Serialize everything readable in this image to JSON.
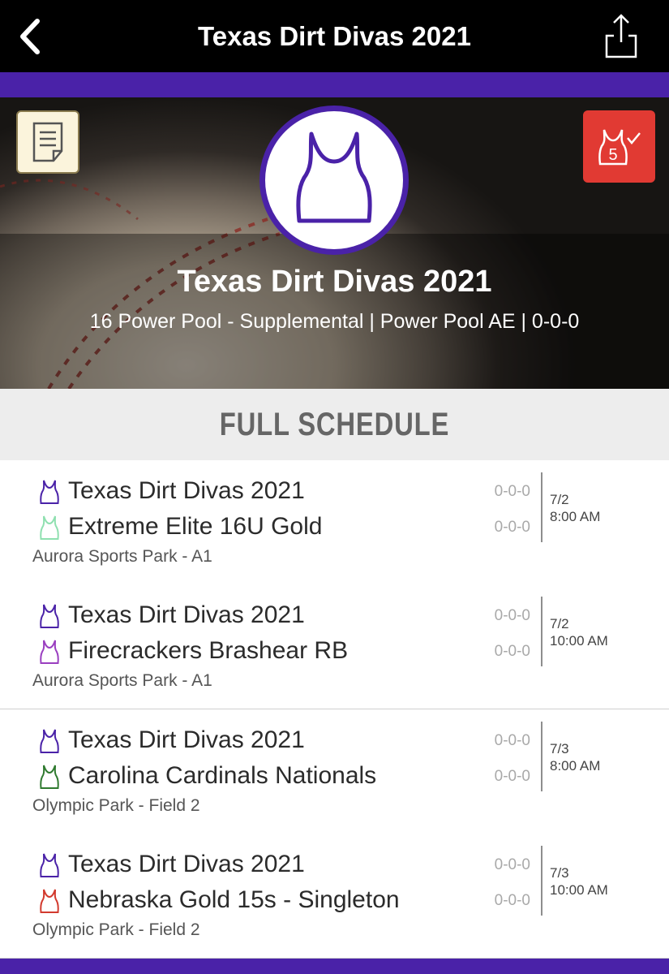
{
  "header": {
    "title": "Texas Dirt Divas 2021"
  },
  "hero": {
    "team_name": "Texas Dirt Divas 2021",
    "subtitle": "16 Power Pool - Supplemental | Power Pool AE | 0-0-0",
    "badge_number": "5"
  },
  "section": {
    "title": "FULL SCHEDULE"
  },
  "games": [
    {
      "home": "Texas Dirt Divas 2021",
      "home_color": "#4a22a8",
      "away": "Extreme Elite 16U Gold",
      "away_color": "#8fe0b0",
      "home_record": "0-0-0",
      "away_record": "0-0-0",
      "date": "7/2",
      "time": "8:00 AM",
      "venue": "Aurora Sports Park - A1"
    },
    {
      "home": "Texas Dirt Divas 2021",
      "home_color": "#4a22a8",
      "away": "Firecrackers Brashear RB",
      "away_color": "#9a3fc0",
      "home_record": "0-0-0",
      "away_record": "0-0-0",
      "date": "7/2",
      "time": "10:00 AM",
      "venue": "Aurora Sports Park - A1"
    },
    {
      "home": "Texas Dirt Divas 2021",
      "home_color": "#4a22a8",
      "away": "Carolina Cardinals Nationals",
      "away_color": "#2f7a2f",
      "home_record": "0-0-0",
      "away_record": "0-0-0",
      "date": "7/3",
      "time": "8:00 AM",
      "venue": "Olympic Park - Field 2"
    },
    {
      "home": "Texas Dirt Divas 2021",
      "home_color": "#4a22a8",
      "away": "Nebraska Gold 15s - Singleton",
      "away_color": "#d23a2e",
      "home_record": "0-0-0",
      "away_record": "0-0-0",
      "date": "7/3",
      "time": "10:00 AM",
      "venue": "Olympic Park - Field 2"
    }
  ],
  "colors": {
    "accent": "#4a22a8",
    "badge_red": "#e13a33"
  }
}
